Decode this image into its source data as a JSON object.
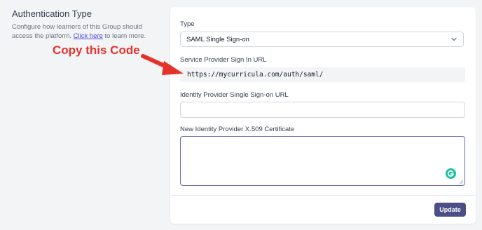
{
  "section": {
    "title": "Authentication Type",
    "description_prefix": "Configure how learners of this Group should access the platform.",
    "link_text": "Click here",
    "description_suffix": " to learn more."
  },
  "form": {
    "type_label": "Type",
    "type_value": "SAML Single Sign-on",
    "sp_label": "Service Provider Sign In URL",
    "sp_url": "https://mycurricula.com/auth/saml/",
    "idp_url_label": "Identity Provider Single Sign-on URL",
    "idp_url_value": "",
    "cert_label": "New Identity Provider X.509 Certificate",
    "cert_value": "",
    "update_label": "Update"
  },
  "annotation": {
    "text": "Copy this Code",
    "color": "#e5322b"
  },
  "icons": {
    "select": "chevron-down-icon",
    "grammarly": "grammarly-icon",
    "arrow": "red-arrow-icon"
  }
}
